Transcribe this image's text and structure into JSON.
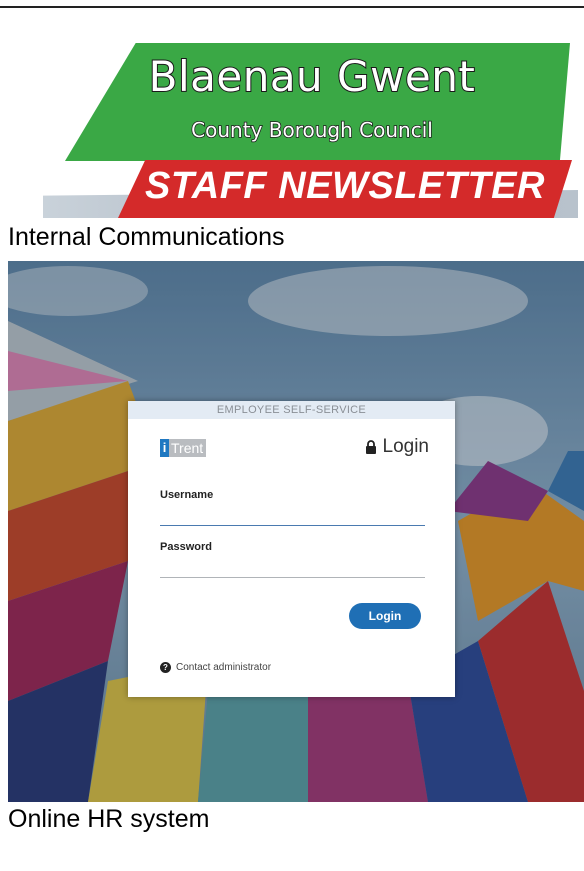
{
  "banner": {
    "title": "Blaenau Gwent",
    "subtitle": "County Borough Council",
    "newsletter": "STAFF NEWSLETTER"
  },
  "captions": {
    "section": "Internal Communications",
    "image": "Online HR system"
  },
  "login_screen": {
    "header": "EMPLOYEE SELF-SERVICE",
    "brand_letter": "i",
    "brand_word": "Trent",
    "login_heading": "Login",
    "username_label": "Username",
    "username_value": "",
    "password_label": "Password",
    "password_value": "",
    "login_button": "Login",
    "contact_link": "Contact administrator",
    "icons": {
      "lock": "lock-icon",
      "help": "question-circle-icon"
    }
  },
  "colors": {
    "banner_green": "#3aa845",
    "banner_red": "#d42a2a",
    "login_button": "#1f6fb5",
    "itrent_blue": "#1f78c1"
  }
}
